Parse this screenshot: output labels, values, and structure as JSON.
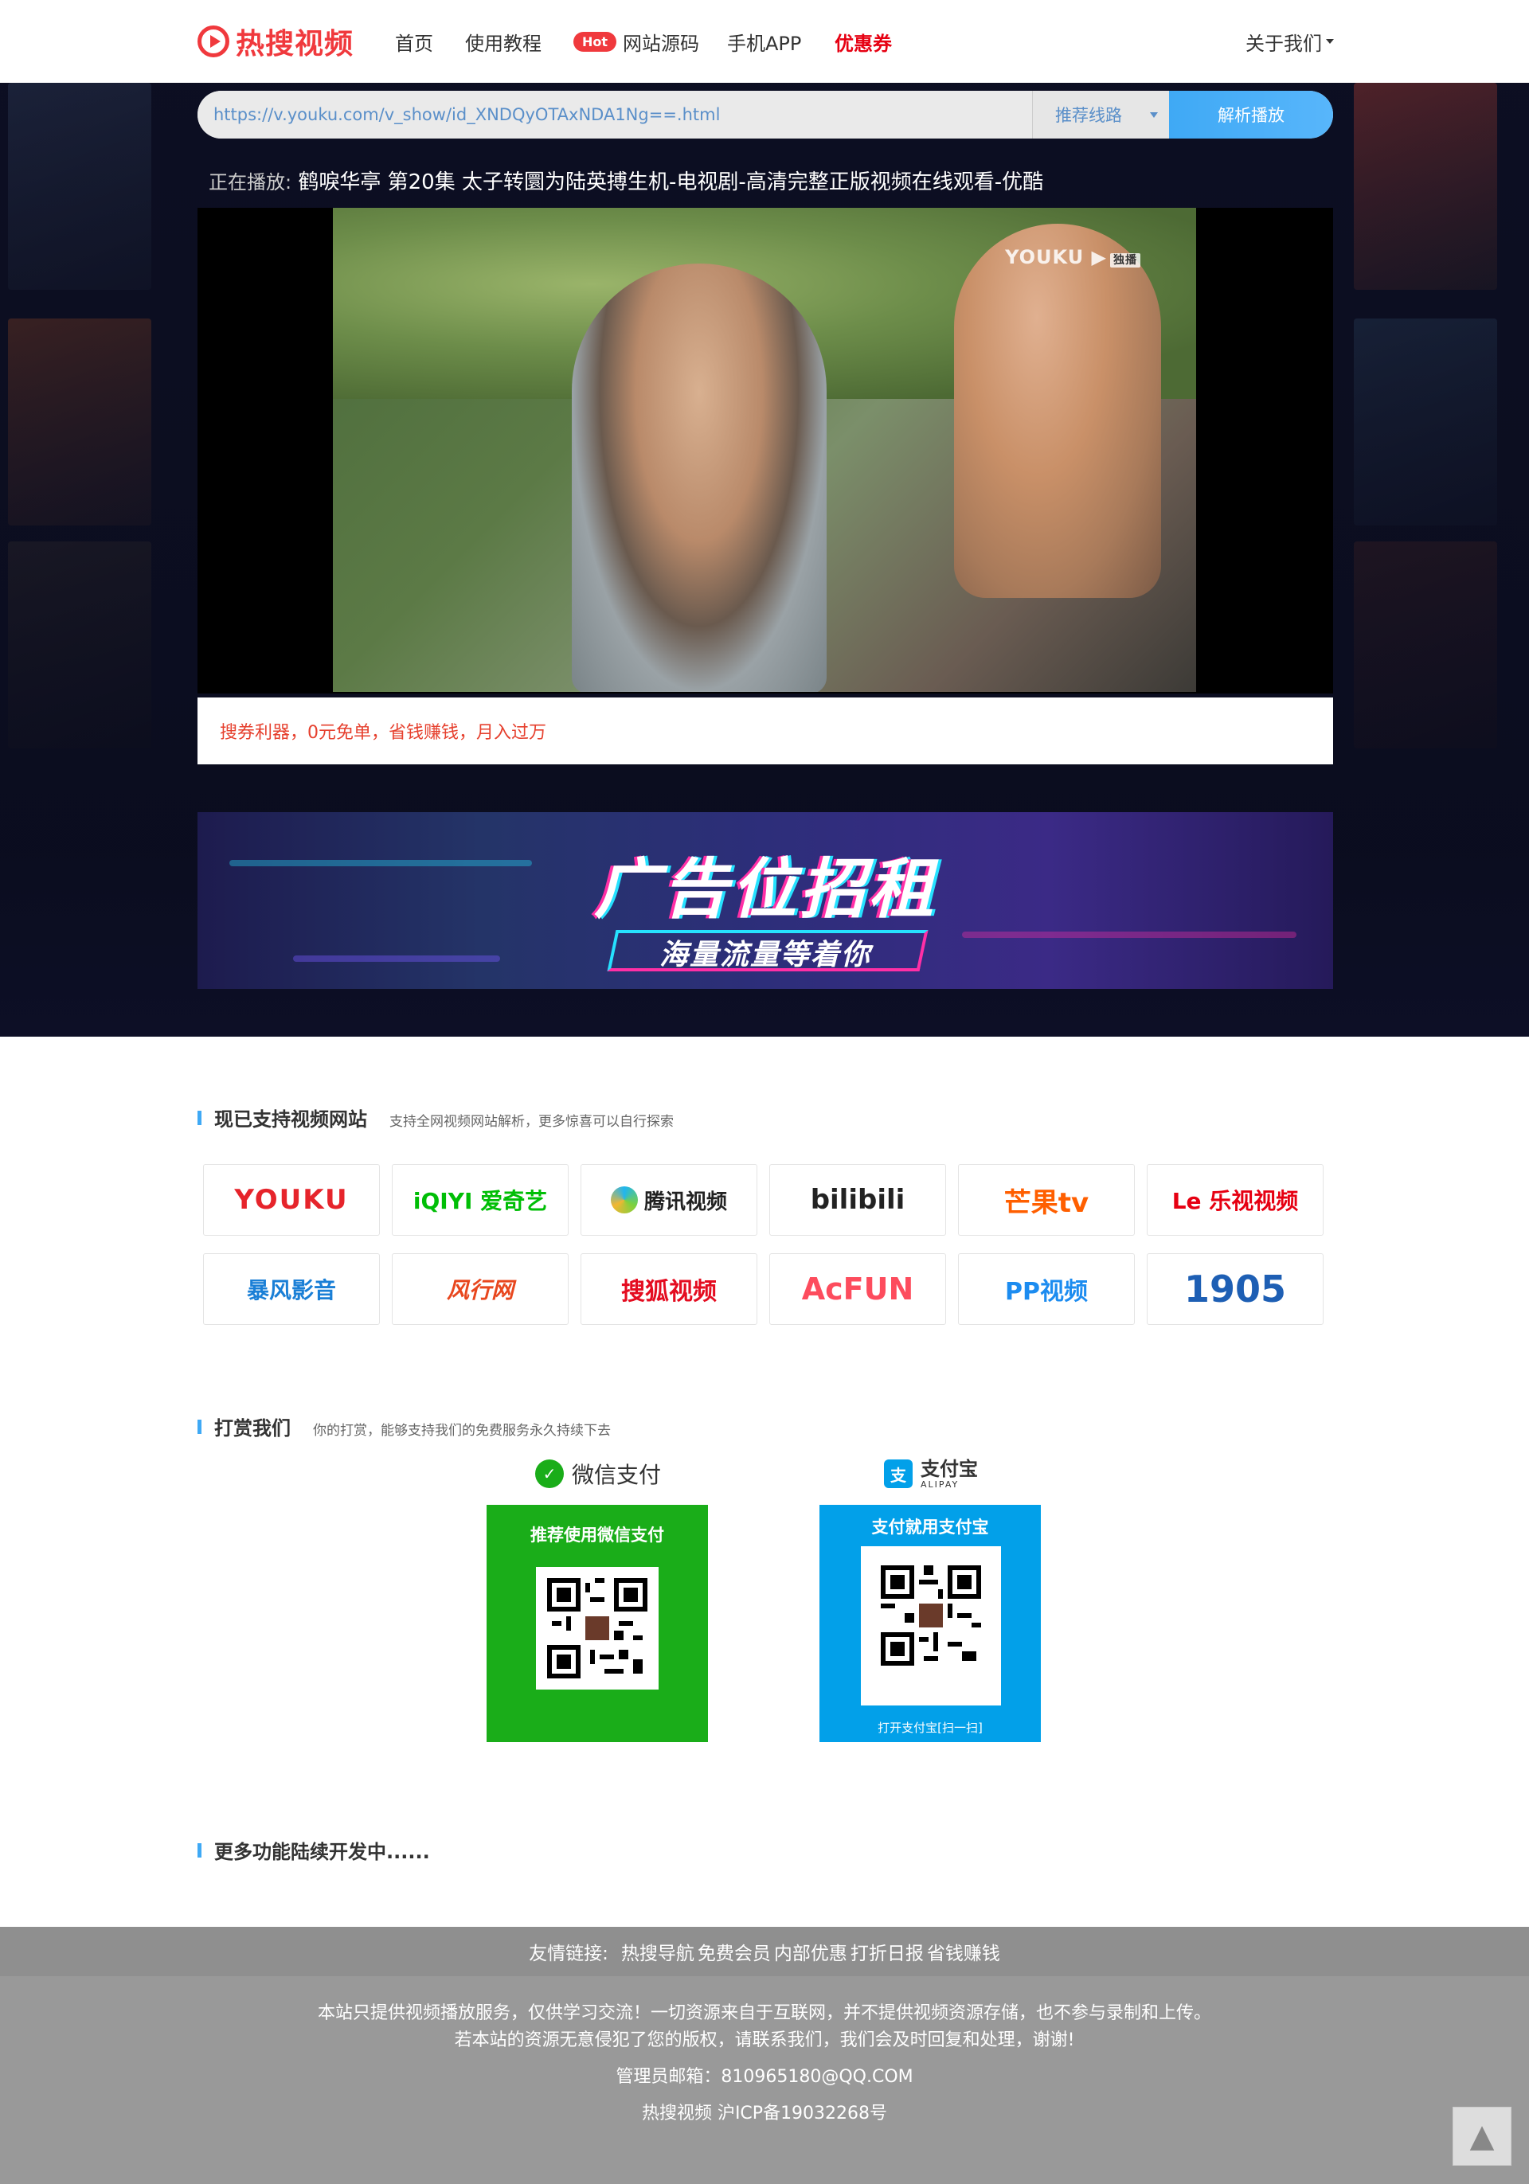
{
  "header": {
    "logo_text": "热搜视频",
    "nav": [
      {
        "label": "首页"
      },
      {
        "label": "使用教程"
      },
      {
        "badge": "Hot",
        "label": "网站源码"
      },
      {
        "label": "手机APP"
      },
      {
        "label": "优惠券"
      }
    ],
    "about": "关于我们"
  },
  "search": {
    "url_value": "https://v.youku.com/v_show/id_XNDQyOTAxNDA1Ng==.html",
    "route_select": "推荐线路",
    "submit_label": "解析播放"
  },
  "player": {
    "now_playing_label": "正在播放:",
    "now_playing_title": "鹤唳华亭 第20集 太子转圜为陆英搏生机-电视剧-高清完整正版视频在线观看-优酷",
    "watermark": "YOUKU",
    "watermark_badge": "独播"
  },
  "notice": "搜券利器，0元免单，省钱赚钱，月入过万",
  "ad": {
    "title": "广告位招租",
    "subtitle": "海量流量等着你"
  },
  "sites_section": {
    "title": "现已支持视频网站",
    "subtitle": "支持全网视频网站解析，更多惊喜可以自行探索",
    "sites": [
      {
        "name": "YOUKU",
        "color": "#e6242b"
      },
      {
        "name": "iQIYI 爱奇艺",
        "color": "#00be06"
      },
      {
        "name": "腾讯视频",
        "color": "#222222"
      },
      {
        "name": "bilibili",
        "color": "#222222"
      },
      {
        "name": "芒果tv",
        "color": "#ff5f00"
      },
      {
        "name": "Le 乐视视频",
        "color": "#e60012"
      },
      {
        "name": "暴风影音",
        "color": "#1a7fd6"
      },
      {
        "name": "风行网",
        "color": "#e8471e"
      },
      {
        "name": "搜狐视频",
        "color": "#e40c20"
      },
      {
        "name": "AcFUN",
        "color": "#fd4c5d"
      },
      {
        "name": "PP视频",
        "color": "#1c8cf0"
      },
      {
        "name": "1905",
        "color": "#1e5fb4"
      }
    ]
  },
  "donate_section": {
    "title": "打赏我们",
    "subtitle": "你的打赏，能够支持我们的免费服务永久持续下去",
    "wechat": {
      "name": "微信支付",
      "caption": "推荐使用微信支付",
      "color": "#1aad19"
    },
    "alipay": {
      "name": "支付宝",
      "sub": "ALIPAY",
      "caption": "支付就用支付宝",
      "footer": "打开支付宝[扫一扫]",
      "color": "#02a0e9"
    }
  },
  "more_section": {
    "title": "更多功能陆续开发中......"
  },
  "footer": {
    "links_label": "友情链接:",
    "links": [
      "热搜导航",
      "免费会员",
      "内部优惠",
      "打折日报",
      "省钱赚钱"
    ],
    "line1": "本站只提供视频播放服务，仅供学习交流！一切资源来自于互联网，并不提供视频资源存储，也不参与录制和上传。",
    "line2": "若本站的资源无意侵犯了您的版权，请联系我们，我们会及时回复和处理，谢谢!",
    "email": "管理员邮箱：810965180@QQ.COM",
    "icp": "热搜视频  沪ICP备19032268号"
  }
}
